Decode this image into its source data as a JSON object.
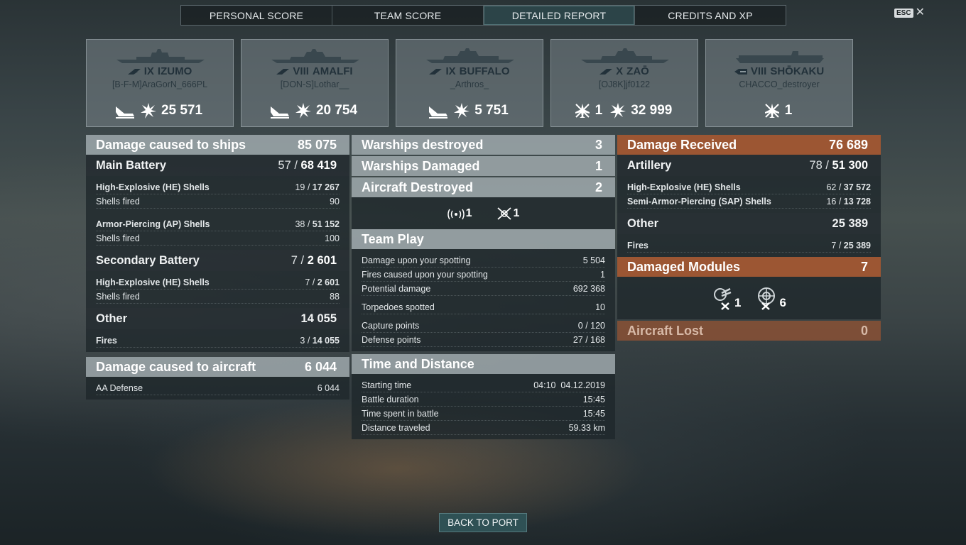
{
  "tabs": [
    "PERSONAL SCORE",
    "TEAM SCORE",
    "DETAILED REPORT",
    "CREDITS AND XP"
  ],
  "active_tab": "DETAILED REPORT",
  "esc": {
    "key": "ESC",
    "close": "✕"
  },
  "ships": [
    {
      "tier": "IX",
      "name": "IZUMO",
      "player": "[B-F-M]AraGorN_666PL",
      "kills": "",
      "damage": "25 571"
    },
    {
      "tier": "VIII",
      "name": "AMALFI",
      "player": "[DON-S]Lothar__",
      "kills": "",
      "damage": "20 754"
    },
    {
      "tier": "IX",
      "name": "BUFFALO",
      "player": "_Arthros_",
      "kills": "",
      "damage": "5 751"
    },
    {
      "tier": "X",
      "name": "ZAŌ",
      "player": "[OJ8K]jf0122",
      "kills": "1",
      "damage": "32 999"
    },
    {
      "tier": "VIII",
      "name": "SHŌKAKU",
      "player": "CHACCO_destroyer",
      "kills": "1",
      "damage": ""
    }
  ],
  "left": {
    "damage_ships": {
      "label": "Damage caused to ships",
      "value": "85 075"
    },
    "main_battery": {
      "label": "Main Battery",
      "hits": "57",
      "dmg": "68 419"
    },
    "mb_lines": {
      "he_label": "High-Explosive (HE) Shells",
      "he_hits": "19",
      "he_dmg": "17 267",
      "he_fired_label": "Shells fired",
      "he_fired": "90",
      "ap_label": "Armor-Piercing (AP) Shells",
      "ap_hits": "38",
      "ap_dmg": "51 152",
      "ap_fired_label": "Shells fired",
      "ap_fired": "100"
    },
    "secondary": {
      "label": "Secondary Battery",
      "hits": "7",
      "dmg": "2 601"
    },
    "sec_lines": {
      "he_label": "High-Explosive (HE) Shells",
      "he_hits": "7",
      "he_dmg": "2 601",
      "fired_label": "Shells fired",
      "fired": "88"
    },
    "other": {
      "label": "Other",
      "value": "14 055"
    },
    "other_lines": {
      "fires_label": "Fires",
      "fires_count": "3",
      "fires_dmg": "14 055"
    },
    "damage_aircraft": {
      "label": "Damage caused to aircraft",
      "value": "6 044"
    },
    "aircraft_lines": {
      "aa_label": "AA Defense",
      "aa_value": "6 044"
    }
  },
  "middle": {
    "warships_destroyed": {
      "label": "Warships destroyed",
      "value": "3"
    },
    "warships_damaged": {
      "label": "Warships Damaged",
      "value": "1"
    },
    "aircraft_destroyed": {
      "label": "Aircraft Destroyed",
      "value": "2"
    },
    "aircraft_icons": {
      "radar_count": "1",
      "plane_count": "1"
    },
    "team_play": {
      "label": "Team Play",
      "rows": [
        {
          "label": "Damage upon your spotting",
          "value": "5 504"
        },
        {
          "label": "Fires caused upon your spotting",
          "value": "1"
        },
        {
          "label": "Potential damage",
          "value": "692 368"
        },
        {
          "label": "Torpedoes spotted",
          "value": "10"
        },
        {
          "label": "Capture points",
          "value": "0 / 120"
        },
        {
          "label": "Defense points",
          "value": "27 / 168"
        }
      ]
    },
    "time_distance": {
      "label": "Time and Distance",
      "rows": [
        {
          "label": "Starting time",
          "value": "04:10  04.12.2019"
        },
        {
          "label": "Battle duration",
          "value": "15:45"
        },
        {
          "label": "Time spent in battle",
          "value": "15:45"
        },
        {
          "label": "Distance traveled",
          "value": "59.33 km"
        }
      ]
    }
  },
  "right": {
    "damage_received": {
      "label": "Damage Received",
      "value": "76 689"
    },
    "artillery": {
      "label": "Artillery",
      "hits": "78",
      "dmg": "51 300"
    },
    "art_lines": {
      "he_label": "High-Explosive (HE) Shells",
      "he_hits": "62",
      "he_dmg": "37 572",
      "sap_label": "Semi-Armor-Piercing (SAP) Shells",
      "sap_hits": "16",
      "sap_dmg": "13 728"
    },
    "other": {
      "label": "Other",
      "value": "25 389"
    },
    "other_lines": {
      "fires_label": "Fires",
      "fires_count": "7",
      "fires_dmg": "25 389"
    },
    "damaged_modules": {
      "label": "Damaged Modules",
      "value": "7"
    },
    "module_icons": {
      "gun_count": "1",
      "engine_count": "6"
    },
    "aircraft_lost": {
      "label": "Aircraft Lost",
      "value": "0"
    }
  },
  "back_button": "BACK TO PORT",
  "colors": {
    "accent_orange": "#9c5633",
    "active_tab": "#2c4448",
    "header_grey": "#a8b2b6"
  }
}
